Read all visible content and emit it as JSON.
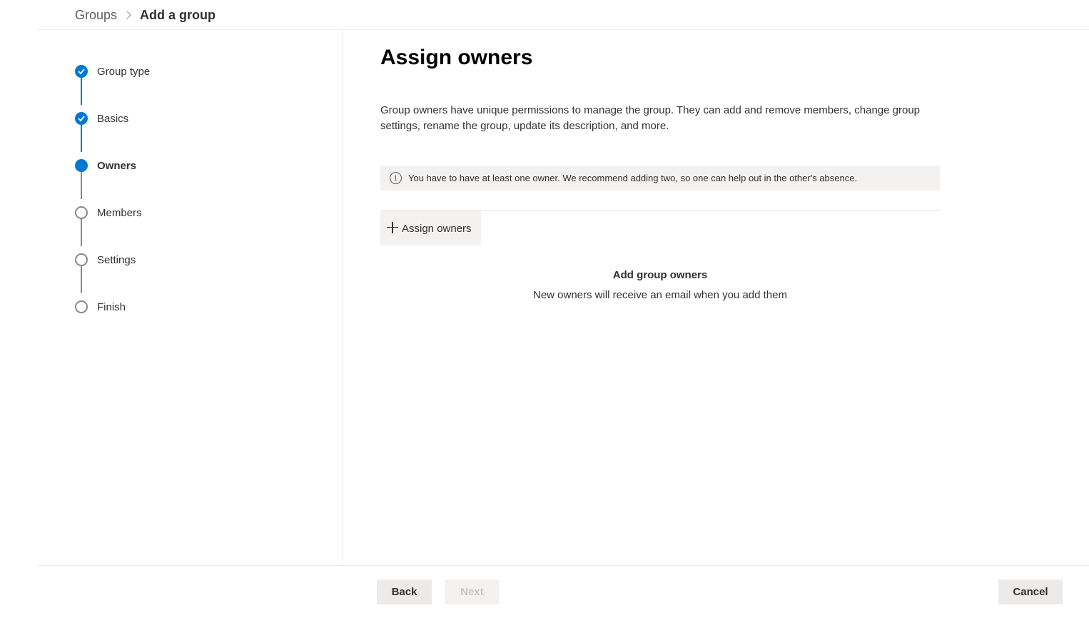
{
  "breadcrumb": {
    "parent": "Groups",
    "current": "Add a group"
  },
  "stepper": {
    "steps": [
      {
        "label": "Group type",
        "state": "done"
      },
      {
        "label": "Basics",
        "state": "done"
      },
      {
        "label": "Owners",
        "state": "current"
      },
      {
        "label": "Members",
        "state": "todo"
      },
      {
        "label": "Settings",
        "state": "todo"
      },
      {
        "label": "Finish",
        "state": "todo"
      }
    ]
  },
  "main": {
    "title": "Assign owners",
    "description": "Group owners have unique permissions to manage the group. They can add and remove members, change group settings, rename the group, update its description, and more.",
    "info_message": "You have to have at least one owner. We recommend adding two, so one can help out in the other's absence.",
    "assign_button_label": "Assign owners",
    "empty_title": "Add group owners",
    "empty_subtitle": "New owners will receive an email when you add them"
  },
  "footer": {
    "back_label": "Back",
    "next_label": "Next",
    "cancel_label": "Cancel"
  },
  "colors": {
    "accent": "#0078d4",
    "todo_step": "#8a8886",
    "info_bg": "#f3f2f1"
  },
  "icons": {
    "breadcrumb_separator": "chevron-right-icon",
    "done_step": "checkmark-icon",
    "info": "info-icon",
    "add": "plus-icon"
  }
}
